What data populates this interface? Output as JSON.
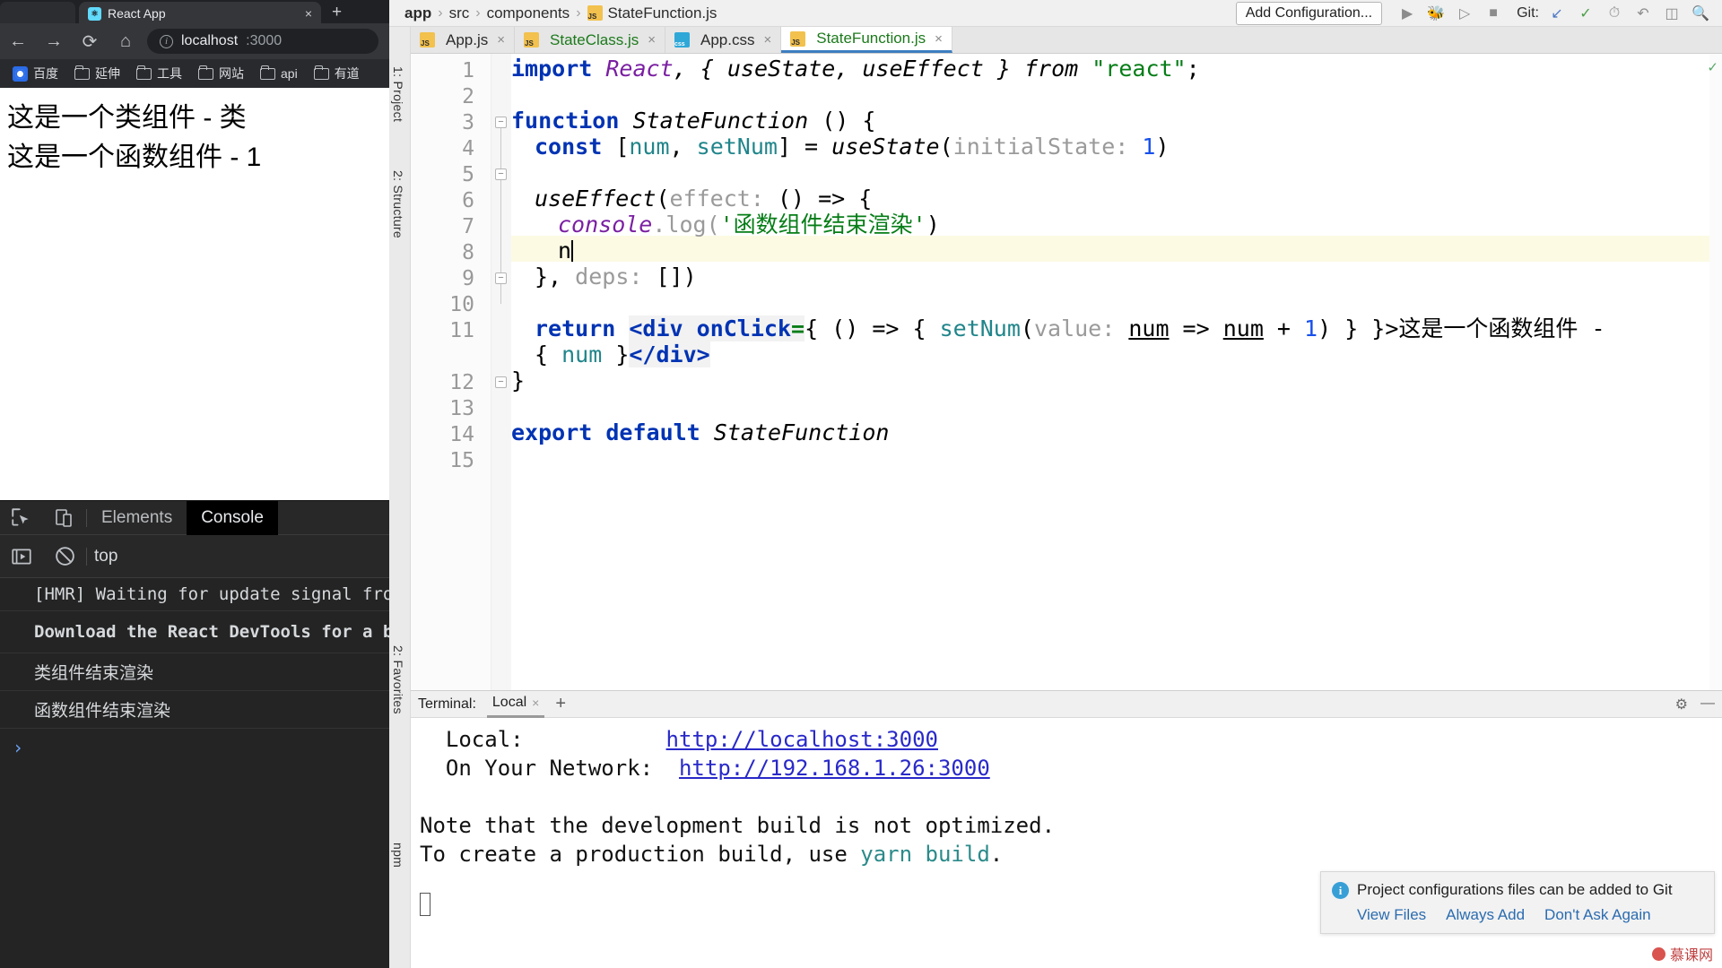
{
  "browser": {
    "tab": {
      "title": "React App",
      "favicon": "react-icon",
      "close": "×"
    },
    "newtab": "+",
    "nav": {
      "back": "←",
      "forward": "→",
      "reload": "⟳",
      "home": "⌂"
    },
    "omnibox": {
      "info_icon": "i",
      "host": "localhost",
      "port": ":3000"
    },
    "bookmarks": [
      {
        "label": "百度",
        "icon": "baidu-favicon"
      },
      {
        "label": "延伸",
        "icon": "folder-icon"
      },
      {
        "label": "工具",
        "icon": "folder-icon"
      },
      {
        "label": "网站",
        "icon": "folder-icon"
      },
      {
        "label": "api",
        "icon": "folder-icon"
      },
      {
        "label": "有道",
        "icon": "folder-icon"
      }
    ],
    "page_lines": [
      "这是一个类组件 - 类",
      "这是一个函数组件 - 1"
    ]
  },
  "devtools": {
    "tabs": [
      {
        "label": "Elements",
        "active": false
      },
      {
        "label": "Console",
        "active": true
      }
    ],
    "icons": {
      "inspect": "inspect-element-icon",
      "device": "device-toolbar-icon",
      "execute": "execute-icon",
      "clear": "clear-console-icon"
    },
    "context": "top",
    "logs": [
      {
        "text": "[HMR] Waiting for update signal from WDS...",
        "bold": false,
        "cn": false
      },
      {
        "text": "Download the React DevTools for a better development experience",
        "bold": true,
        "cn": false
      },
      {
        "text": "类组件结束渲染",
        "bold": false,
        "cn": true
      },
      {
        "text": "函数组件结束渲染",
        "bold": false,
        "cn": true
      }
    ],
    "prompt": "›"
  },
  "ide": {
    "breadcrumbs": [
      {
        "label": "app",
        "bold": true,
        "icon": ""
      },
      {
        "label": "src",
        "bold": false,
        "icon": ""
      },
      {
        "label": "components",
        "bold": false,
        "icon": ""
      },
      {
        "label": "StateFunction.js",
        "bold": false,
        "icon": "js-file-icon"
      }
    ],
    "breadcrumb_sep": "›",
    "add_configuration": "Add Configuration...",
    "toolbar_icons": {
      "run": "run-icon",
      "debug": "debug-icon",
      "coverage": "run-with-coverage-icon",
      "stop": "stop-icon",
      "git_label": "Git:",
      "update": "git-update-icon",
      "commit": "git-commit-icon",
      "history": "history-icon",
      "undo": "undo-icon",
      "search_everywhere": "search-everywhere-icon",
      "search": "search-icon"
    },
    "left_strip": [
      {
        "label": "1: Project"
      },
      {
        "label": "2: Structure"
      },
      {
        "label": "2: Favorites"
      },
      {
        "label": "npm"
      }
    ],
    "editor_tabs": [
      {
        "label": "App.js",
        "icon": "js-file-icon",
        "active": false,
        "color": "js"
      },
      {
        "label": "StateClass.js",
        "icon": "js-file-icon",
        "active": false,
        "color": "green"
      },
      {
        "label": "App.css",
        "icon": "css-file-icon",
        "active": false,
        "color": "js"
      },
      {
        "label": "StateFunction.js",
        "icon": "js-file-icon",
        "active": true,
        "color": "green"
      }
    ],
    "tab_close": "×",
    "gutter_numbers": [
      "1",
      "2",
      "3",
      "4",
      "5",
      "6",
      "7",
      "8",
      "9",
      "10",
      "11",
      "12",
      "13",
      "14",
      "15"
    ],
    "code": {
      "l1_import": "import",
      "l1_react": "React",
      "l1_braces": ", { useState, useEffect } from ",
      "l1_module": "\"react\"",
      "l1_semi": ";",
      "l3_function": "function",
      "l3_name": "StateFunction",
      "l3_rest": " () {",
      "l4_const": "const",
      "l4_open": " [",
      "l4_num": "num",
      "l4_comma": ", ",
      "l4_setnum": "setNum",
      "l4_close": "] = ",
      "l4_usestate": "useState",
      "l4_paren": "(",
      "l4_hint": "initialState:",
      "l4_val": "1",
      "l4_end": ")",
      "l6_useeffect": "useEffect",
      "l6_paren": "(",
      "l6_hint": "effect:",
      "l6_rest": "() => {",
      "l7_console": "console",
      "l7_dot": ".log(",
      "l7_str": "'函数组件结束渲染'",
      "l7_end": ")",
      "l8_text": "n",
      "l9_text": "},",
      "l9_hint": "deps:",
      "l9_rest": "[])",
      "l11_return": "return",
      "l11_tag_open": "<div",
      "l11_attr": "onClick",
      "l11_eq": "=",
      "l11_body": "{ () => { ",
      "l11_setnum": "setNum",
      "l11_p": "(",
      "l11_hint": "value:",
      "l11_num1": "num",
      "l11_arrow": " => ",
      "l11_num2": "num",
      "l11_plus": " + ",
      "l11_one": "1",
      "l11_close": ") } }>",
      "l11_cn": "这是一个函数组件 -",
      "l11b_open": "{ ",
      "l11b_num": "num",
      "l11b_close": " }",
      "l11b_tag": "</div>",
      "l12_text": "}",
      "l14_export": "export default",
      "l14_name": "StateFunction"
    },
    "terminal": {
      "label": "Terminal:",
      "tab": "Local",
      "tab_close": "×",
      "new_tab": "+",
      "settings": "gear-icon",
      "hide": "—",
      "lines": [
        {
          "type": "kv",
          "key": "  Local:           ",
          "value": "http://localhost:3000",
          "link": true
        },
        {
          "type": "kv",
          "key": "  On Your Network:  ",
          "value": "http://192.168.1.26:3000",
          "link": true
        },
        {
          "type": "blank",
          "text": ""
        },
        {
          "type": "plain",
          "text": "Note that the development build is not optimized."
        },
        {
          "type": "mixed",
          "pre": "To create a production build, use ",
          "accent": "yarn build",
          "post": "."
        }
      ]
    },
    "notification": {
      "icon": "info-icon",
      "message": "Project configurations files can be added to Git",
      "actions": [
        "View Files",
        "Always Add",
        "Don't Ask Again"
      ]
    },
    "watermark": "慕课网"
  }
}
